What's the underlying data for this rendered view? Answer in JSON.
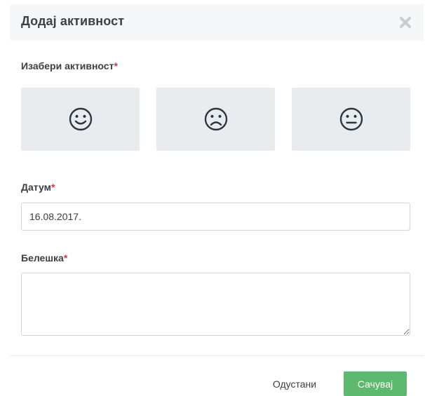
{
  "modal": {
    "title": "Додај активност",
    "close_icon": "close-x-icon"
  },
  "activity": {
    "label": "Изабери активност",
    "required_mark": "*",
    "options": [
      {
        "icon": "smile-face-icon"
      },
      {
        "icon": "sad-face-icon"
      },
      {
        "icon": "neutral-face-icon"
      }
    ]
  },
  "date": {
    "label": "Датум",
    "required_mark": "*",
    "value": "16.08.2017."
  },
  "note": {
    "label": "Белешка",
    "required_mark": "*",
    "value": ""
  },
  "footer": {
    "cancel_label": "Одустани",
    "save_label": "Сачувај"
  },
  "colors": {
    "save_button": "#5cb96d",
    "tile_background": "#e8ecef",
    "required": "#d9343c",
    "header_background": "#f6f7f8"
  }
}
